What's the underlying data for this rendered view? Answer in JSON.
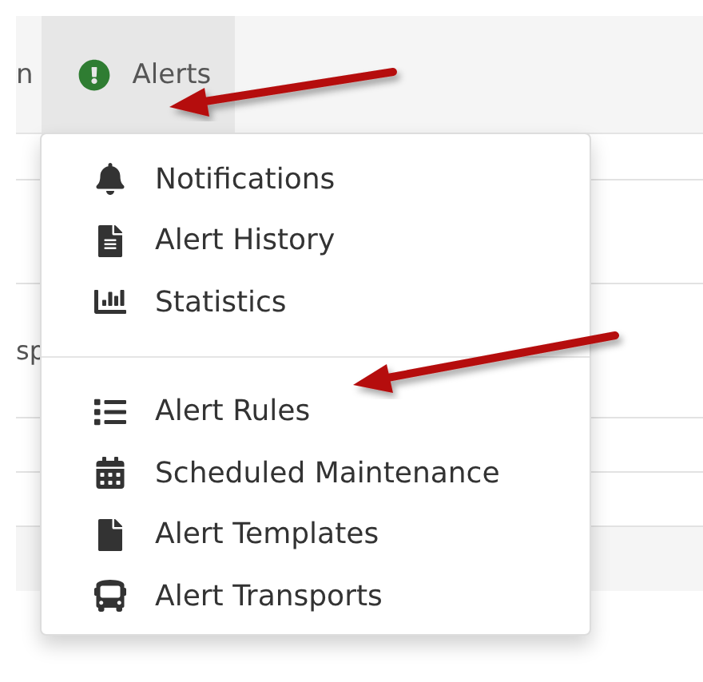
{
  "navbar": {
    "items": [
      {
        "label": "n",
        "selected": false
      },
      {
        "label": "Alerts",
        "selected": true
      }
    ]
  },
  "background_rows": [
    {
      "text": ""
    },
    {
      "text": ""
    },
    {
      "text": "sp"
    },
    {
      "text": ""
    },
    {
      "text": ""
    }
  ],
  "dropdown": {
    "sections": [
      {
        "items": [
          {
            "label": "Notifications"
          },
          {
            "label": "Alert History"
          },
          {
            "label": "Statistics"
          }
        ]
      },
      {
        "items": [
          {
            "label": "Alert Rules"
          },
          {
            "label": "Scheduled Maintenance"
          },
          {
            "label": "Alert Templates"
          },
          {
            "label": "Alert Transports"
          }
        ]
      }
    ]
  }
}
